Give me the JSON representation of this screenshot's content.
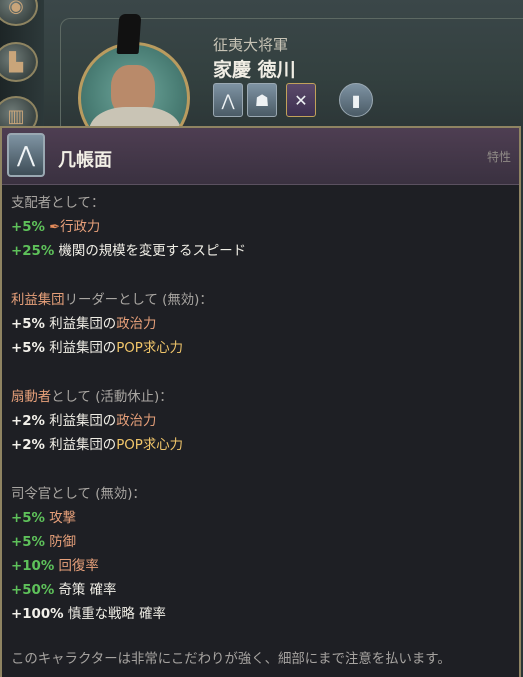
{
  "character": {
    "title": "征夷大将軍",
    "name": "家慶 徳川",
    "trait_icons": [
      "tweezers-icon",
      "monk-icon",
      "windmill-icon",
      "candles-icon"
    ]
  },
  "side_buttons": [
    "map-icon",
    "factory-icon",
    "building-icon"
  ],
  "tooltip": {
    "icon": "tweezers-icon",
    "title": "几帳面",
    "type_label": "特性",
    "ruler": {
      "heading": "支配者として：",
      "items": [
        {
          "value": "+5%",
          "icon": "bureaucracy-icon",
          "label": "行政力"
        },
        {
          "value": "+25%",
          "label": "機関の規模を変更するスピード"
        }
      ]
    },
    "ig_leader": {
      "heading_highlight": "利益集団",
      "heading_rest": "リーダーとして (無効)：",
      "items": [
        {
          "value": "+5%",
          "label_a": "利益集団の",
          "label_b": "政治力"
        },
        {
          "value": "+5%",
          "label_a": "利益集団の",
          "label_b": "POP求心力"
        }
      ]
    },
    "agitator": {
      "heading_highlight": "扇動者",
      "heading_rest": "として (活動休止)：",
      "items": [
        {
          "value": "+2%",
          "label_a": "利益集団の",
          "label_b": "政治力"
        },
        {
          "value": "+2%",
          "label_a": "利益集団の",
          "label_b": "POP求心力"
        }
      ]
    },
    "commander": {
      "heading": "司令官として (無効)：",
      "items": [
        {
          "value": "+5%",
          "label": "攻撃"
        },
        {
          "value": "+5%",
          "label": "防御"
        },
        {
          "value": "+10%",
          "label": "回復率"
        },
        {
          "value": "+50%",
          "label": "奇策 確率"
        },
        {
          "value": "+100%",
          "label": "慎重な戦略 確率"
        }
      ]
    },
    "description": "このキャラクターは非常にこだわりが強く、細部にまで注意を払います。"
  },
  "colors": {
    "positive": "#5ec15a",
    "highlight": "#e7a07a",
    "border_gold": "#8f8462"
  }
}
